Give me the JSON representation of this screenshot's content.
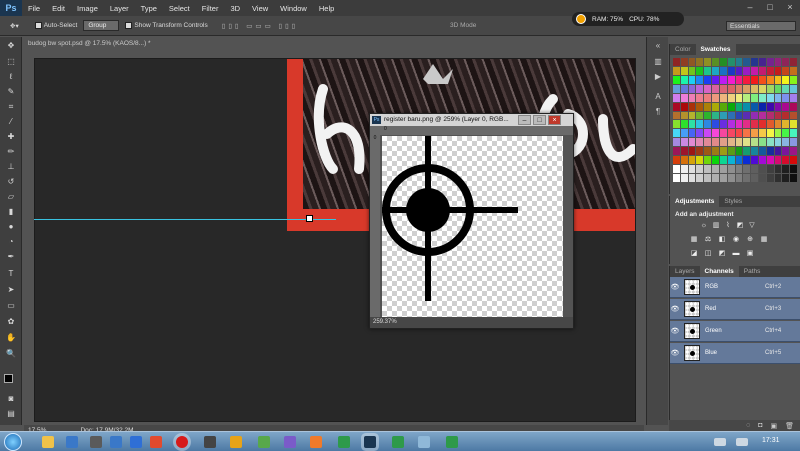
{
  "app": {
    "logo": "Ps",
    "menu": [
      "File",
      "Edit",
      "Image",
      "Layer",
      "Type",
      "Select",
      "Filter",
      "3D",
      "View",
      "Window",
      "Help"
    ],
    "resource_meter": {
      "ram": "RAM: 75%",
      "cpu": "CPU: 78%"
    },
    "window_controls": [
      "–",
      "□",
      "×"
    ]
  },
  "options_bar": {
    "auto_select_label": "Auto-Select",
    "auto_select_mode": "Group",
    "show_transform_label": "Show Transform Controls",
    "mode_3d": "3D Mode",
    "workspace": "Essentials"
  },
  "document": {
    "tab_title": "budog bw spot.psd @ 17.5% (KAOS/8...) *",
    "zoom": "17.5%",
    "doc_info": "Doc: 17.9M/32.2M"
  },
  "floating_window": {
    "title": "register baru.png @ 259% (Layer 0, RGB...",
    "ruler_top": "0",
    "ruler_left": "0",
    "zoom": "259.37%"
  },
  "panels": {
    "color_tabs": [
      "Color",
      "Swatches"
    ],
    "adjustments_tabs": [
      "Adjustments",
      "Styles"
    ],
    "adjustments_label": "Add an adjustment",
    "layers_tabs": [
      "Layers",
      "Channels",
      "Paths"
    ],
    "channels": [
      {
        "name": "RGB",
        "shortcut": "Ctrl+2"
      },
      {
        "name": "Red",
        "shortcut": "Ctrl+3"
      },
      {
        "name": "Green",
        "shortcut": "Ctrl+4"
      },
      {
        "name": "Blue",
        "shortcut": "Ctrl+5"
      }
    ]
  },
  "taskbar": {
    "clock": "17:31"
  },
  "colors": {
    "accent_guide": "#39c2e0",
    "art_red": "#d8392a",
    "channel_highlight": "#64799a"
  }
}
